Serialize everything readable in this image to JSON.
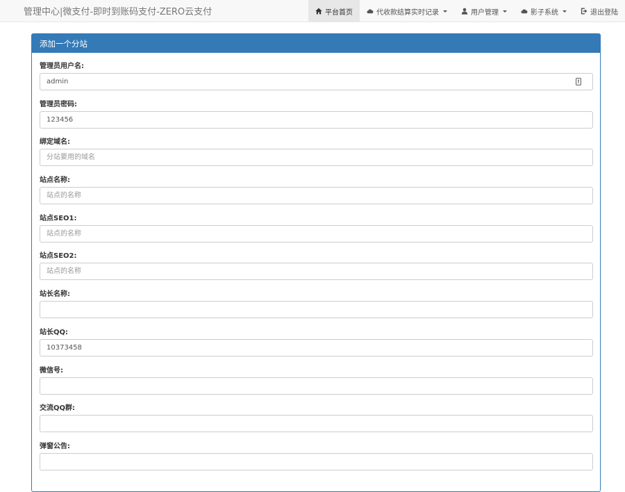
{
  "header": {
    "brand": "管理中心|微支付-即时到账码支付-ZERO云支付",
    "nav": [
      {
        "icon": "home-icon",
        "label": "平台首页",
        "active": true,
        "caret": false
      },
      {
        "icon": "cloud-icon",
        "label": "代收款结算实时记录",
        "active": false,
        "caret": true
      },
      {
        "icon": "user-icon",
        "label": "用户管理",
        "active": false,
        "caret": true
      },
      {
        "icon": "cloud-icon",
        "label": "影子系统",
        "active": false,
        "caret": true
      },
      {
        "icon": "logout-icon",
        "label": "退出登陆",
        "active": false,
        "caret": false
      }
    ]
  },
  "panel": {
    "title": "添加一个分站",
    "fields": [
      {
        "label": "管理员用户名:",
        "value": "admin",
        "placeholder": ""
      },
      {
        "label": "管理员密码:",
        "value": "123456",
        "placeholder": ""
      },
      {
        "label": "绑定域名:",
        "value": "",
        "placeholder": "分站要用的域名"
      },
      {
        "label": "站点名称:",
        "value": "",
        "placeholder": "站点的名称"
      },
      {
        "label": "站点SEO1:",
        "value": "",
        "placeholder": "站点的名称"
      },
      {
        "label": "站点SEO2:",
        "value": "",
        "placeholder": "站点的名称"
      },
      {
        "label": "站长名称:",
        "value": "",
        "placeholder": ""
      },
      {
        "label": "站长QQ:",
        "value": "10373458",
        "placeholder": ""
      },
      {
        "label": "微信号:",
        "value": "",
        "placeholder": ""
      },
      {
        "label": "交流QQ群:",
        "value": "",
        "placeholder": ""
      },
      {
        "label": "弹窗公告:",
        "value": "",
        "placeholder": ""
      }
    ]
  },
  "colors": {
    "primary": "#337ab7",
    "navbar_bg": "#f8f8f8",
    "active_nav_bg": "#e7e7e7",
    "input_border": "#cccccc"
  }
}
